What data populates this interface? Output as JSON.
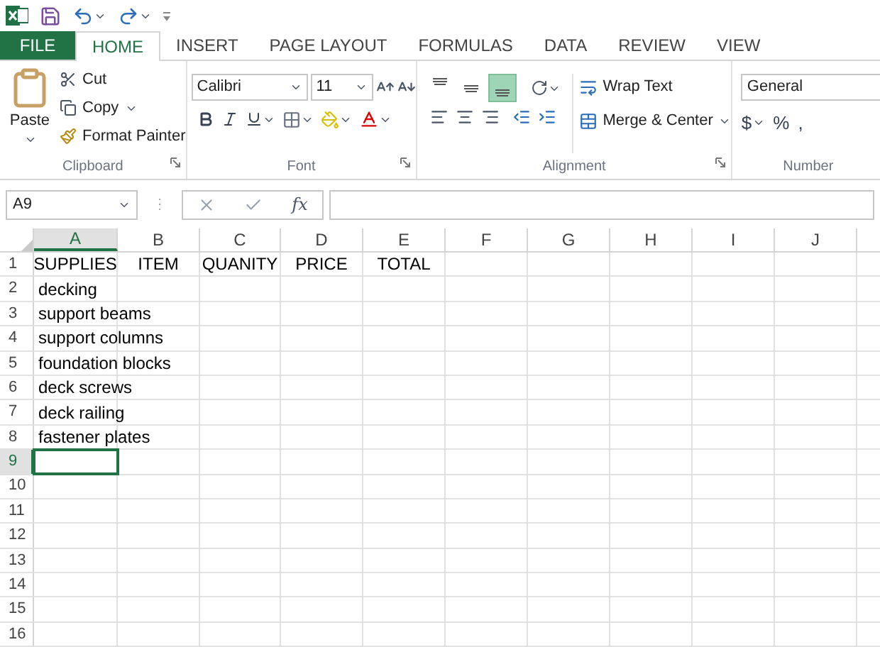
{
  "tabs": [
    {
      "label": "FILE",
      "kind": "file",
      "selected": false
    },
    {
      "label": "HOME",
      "kind": "tab",
      "selected": true
    },
    {
      "label": "INSERT",
      "kind": "tab",
      "selected": false
    },
    {
      "label": "PAGE LAYOUT",
      "kind": "tab",
      "selected": false
    },
    {
      "label": "FORMULAS",
      "kind": "tab",
      "selected": false
    },
    {
      "label": "DATA",
      "kind": "tab",
      "selected": false
    },
    {
      "label": "REVIEW",
      "kind": "tab",
      "selected": false
    },
    {
      "label": "VIEW",
      "kind": "tab",
      "selected": false
    }
  ],
  "clipboard": {
    "paste": "Paste",
    "cut": "Cut",
    "copy": "Copy",
    "format_painter": "Format Painter",
    "label": "Clipboard"
  },
  "font": {
    "name": "Calibri",
    "size": "11",
    "label": "Font"
  },
  "alignment": {
    "vertical": [
      {
        "kind": "top",
        "selected": false
      },
      {
        "kind": "middle",
        "selected": false
      },
      {
        "kind": "bottom",
        "selected": true
      }
    ],
    "wrap_text": "Wrap Text",
    "merge_center": "Merge & Center",
    "label": "Alignment"
  },
  "number": {
    "format": "General",
    "symbols": [
      "$",
      "%",
      ","
    ],
    "label": "Number"
  },
  "formula_bar": {
    "name_box": "A9",
    "function_symbol": "fx"
  },
  "columns": [
    {
      "label": "A",
      "selected": true
    },
    {
      "label": "B",
      "selected": false
    },
    {
      "label": "C",
      "selected": false
    },
    {
      "label": "D",
      "selected": false
    },
    {
      "label": "E",
      "selected": false
    },
    {
      "label": "F",
      "selected": false
    },
    {
      "label": "G",
      "selected": false
    },
    {
      "label": "H",
      "selected": false
    },
    {
      "label": "I",
      "selected": false
    },
    {
      "label": "J",
      "selected": false
    }
  ],
  "rows": [
    {
      "number": "1",
      "kind": "header",
      "selected": false,
      "cells": [
        "SUPPLIES",
        "ITEM",
        "QUANITY",
        "PRICE",
        "TOTAL"
      ]
    },
    {
      "number": "2",
      "kind": "data",
      "selected": false,
      "cells": [
        "decking"
      ]
    },
    {
      "number": "3",
      "kind": "data",
      "selected": false,
      "cells": [
        "support beams"
      ]
    },
    {
      "number": "4",
      "kind": "data",
      "selected": false,
      "cells": [
        "support columns"
      ]
    },
    {
      "number": "5",
      "kind": "data",
      "selected": false,
      "cells": [
        "foundation blocks"
      ]
    },
    {
      "number": "6",
      "kind": "data",
      "selected": false,
      "cells": [
        "deck screws"
      ]
    },
    {
      "number": "7",
      "kind": "data",
      "selected": false,
      "cells": [
        "deck railing"
      ]
    },
    {
      "number": "8",
      "kind": "data",
      "selected": false,
      "cells": [
        "fastener plates"
      ]
    },
    {
      "number": "9",
      "kind": "data",
      "selected": true,
      "cells": []
    },
    {
      "number": "10",
      "kind": "data",
      "selected": false,
      "cells": []
    },
    {
      "number": "11",
      "kind": "data",
      "selected": false,
      "cells": []
    },
    {
      "number": "12",
      "kind": "data",
      "selected": false,
      "cells": []
    },
    {
      "number": "13",
      "kind": "data",
      "selected": false,
      "cells": []
    },
    {
      "number": "14",
      "kind": "data",
      "selected": false,
      "cells": []
    },
    {
      "number": "15",
      "kind": "data",
      "selected": false,
      "cells": []
    },
    {
      "number": "16",
      "kind": "data",
      "selected": false,
      "cells": []
    }
  ]
}
